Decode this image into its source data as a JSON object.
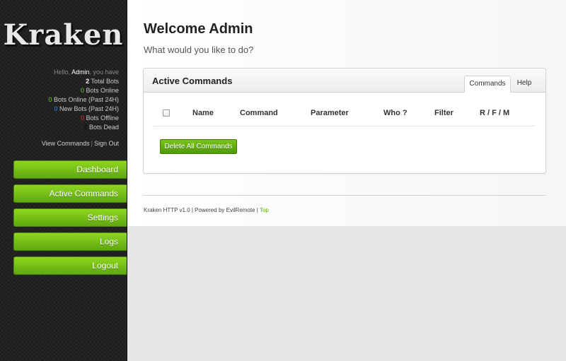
{
  "sidebar": {
    "logo": "Kraken",
    "greeting": {
      "prefix": "Hello, ",
      "name": "Admin",
      "suffix": ", you have"
    },
    "stats": [
      {
        "count": "2",
        "label": "Total Bots",
        "color": "#ffffff"
      },
      {
        "count": "0",
        "label": "Bots Online",
        "color": "#5dd12b"
      },
      {
        "count": "0",
        "label": "Bots Online (Past 24H)",
        "color": "#5dd12b"
      },
      {
        "count": "0",
        "label": "New Bots (Past 24H)",
        "color": "#2f8de4"
      },
      {
        "count": "0",
        "label": "Bots Offline",
        "color": "#e33131"
      },
      {
        "count": "2",
        "label": "Bots Dead",
        "color": "#111111"
      }
    ],
    "links": {
      "view_commands": "View Commands",
      "separator": "|",
      "sign_out": "Sign Out"
    },
    "nav": [
      {
        "label": "Dashboard"
      },
      {
        "label": "Active Commands"
      },
      {
        "label": "Settings"
      },
      {
        "label": "Logs"
      },
      {
        "label": "Logout"
      }
    ],
    "accent_color": "#6fbf14"
  },
  "main": {
    "title": "Welcome Admin",
    "subtitle": "What would you like to do?",
    "panel": {
      "title": "Active Commands",
      "tabs": [
        {
          "label": "Commands",
          "active": true
        },
        {
          "label": "Help",
          "active": false
        }
      ],
      "table": {
        "columns": [
          "Name",
          "Command",
          "Parameter",
          "Who ?",
          "Filter",
          "R / F / M"
        ],
        "rows": []
      },
      "delete_button": "Delete All Commands"
    },
    "footer": {
      "text": "Kraken HTTP v1.0 | Powered by EvilRemote | ",
      "top_link": "Top"
    }
  }
}
